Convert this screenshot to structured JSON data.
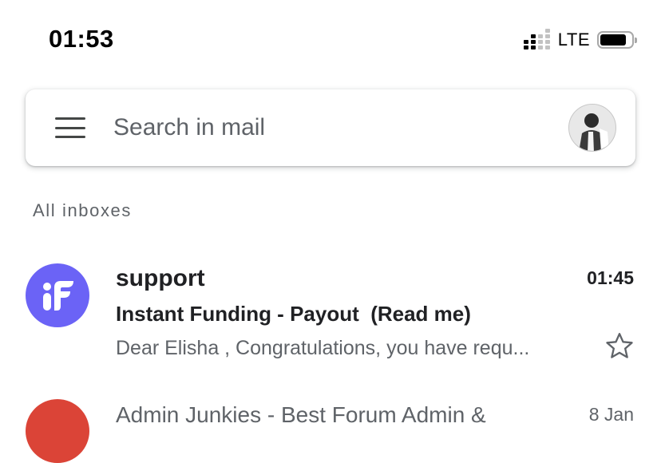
{
  "status_bar": {
    "time": "01:53",
    "network": "LTE",
    "signal_icon": "cellular-signal-icon",
    "battery_icon": "battery-icon",
    "battery_level": 0.85
  },
  "search": {
    "menu_icon": "hamburger-menu-icon",
    "placeholder": "Search in mail",
    "avatar": "account-avatar"
  },
  "section": {
    "label": "All inboxes"
  },
  "emails": [
    {
      "sender": "support",
      "time": "01:45",
      "subject": "Instant Funding - Payout  (Read me)",
      "snippet": "Dear Elisha , Congratulations, you have requ...",
      "avatar_color": "#6b63f6",
      "avatar_icon": "instant-funding-logo-icon",
      "star_icon": "star-outline-icon",
      "unread": true
    },
    {
      "sender": "Admin Junkies - Best Forum Admin &",
      "date": "8 Jan",
      "avatar_color": "#db4437"
    }
  ],
  "colors": {
    "primary_text": "#202124",
    "secondary_text": "#5f6368",
    "accent_purple": "#6b63f6",
    "accent_red": "#db4437"
  }
}
